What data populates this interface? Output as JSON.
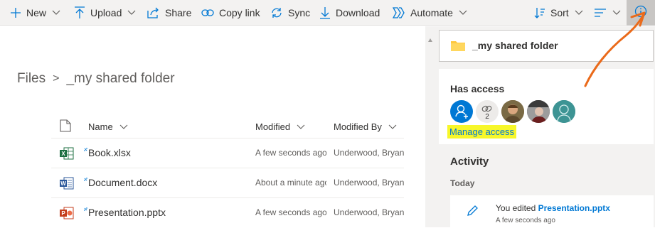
{
  "toolbar": {
    "new_label": "New",
    "upload_label": "Upload",
    "share_label": "Share",
    "copy_link_label": "Copy link",
    "sync_label": "Sync",
    "download_label": "Download",
    "automate_label": "Automate",
    "sort_label": "Sort",
    "accent_color": "#0078d4"
  },
  "breadcrumb": {
    "root": "Files",
    "separator": ">",
    "current": "_my shared folder"
  },
  "columns": {
    "name": "Name",
    "modified": "Modified",
    "modified_by": "Modified By"
  },
  "files": [
    {
      "name": "Book.xlsx",
      "icon": "excel-icon",
      "modified": "A few seconds ago",
      "modified_by": "Underwood, Bryan",
      "icon_color": "#1d6f42"
    },
    {
      "name": "Document.docx",
      "icon": "word-icon",
      "modified": "About a minute ago",
      "modified_by": "Underwood, Bryan",
      "icon_color": "#2b579a"
    },
    {
      "name": "Presentation.pptx",
      "icon": "powerpoint-icon",
      "modified": "A few seconds ago",
      "modified_by": "Underwood, Bryan",
      "icon_color": "#c43e1c"
    }
  ],
  "details": {
    "folder_name": "_my shared folder",
    "folder_color": "#ffc83d",
    "has_access_title": "Has access",
    "link_count": "2",
    "manage_access_label": "Manage access",
    "activity_title": "Activity",
    "today_label": "Today",
    "activity_prefix": "You edited",
    "activity_file": "Presentation.pptx",
    "activity_time": "A few seconds ago"
  },
  "annotation_color": "#ea6a1a"
}
